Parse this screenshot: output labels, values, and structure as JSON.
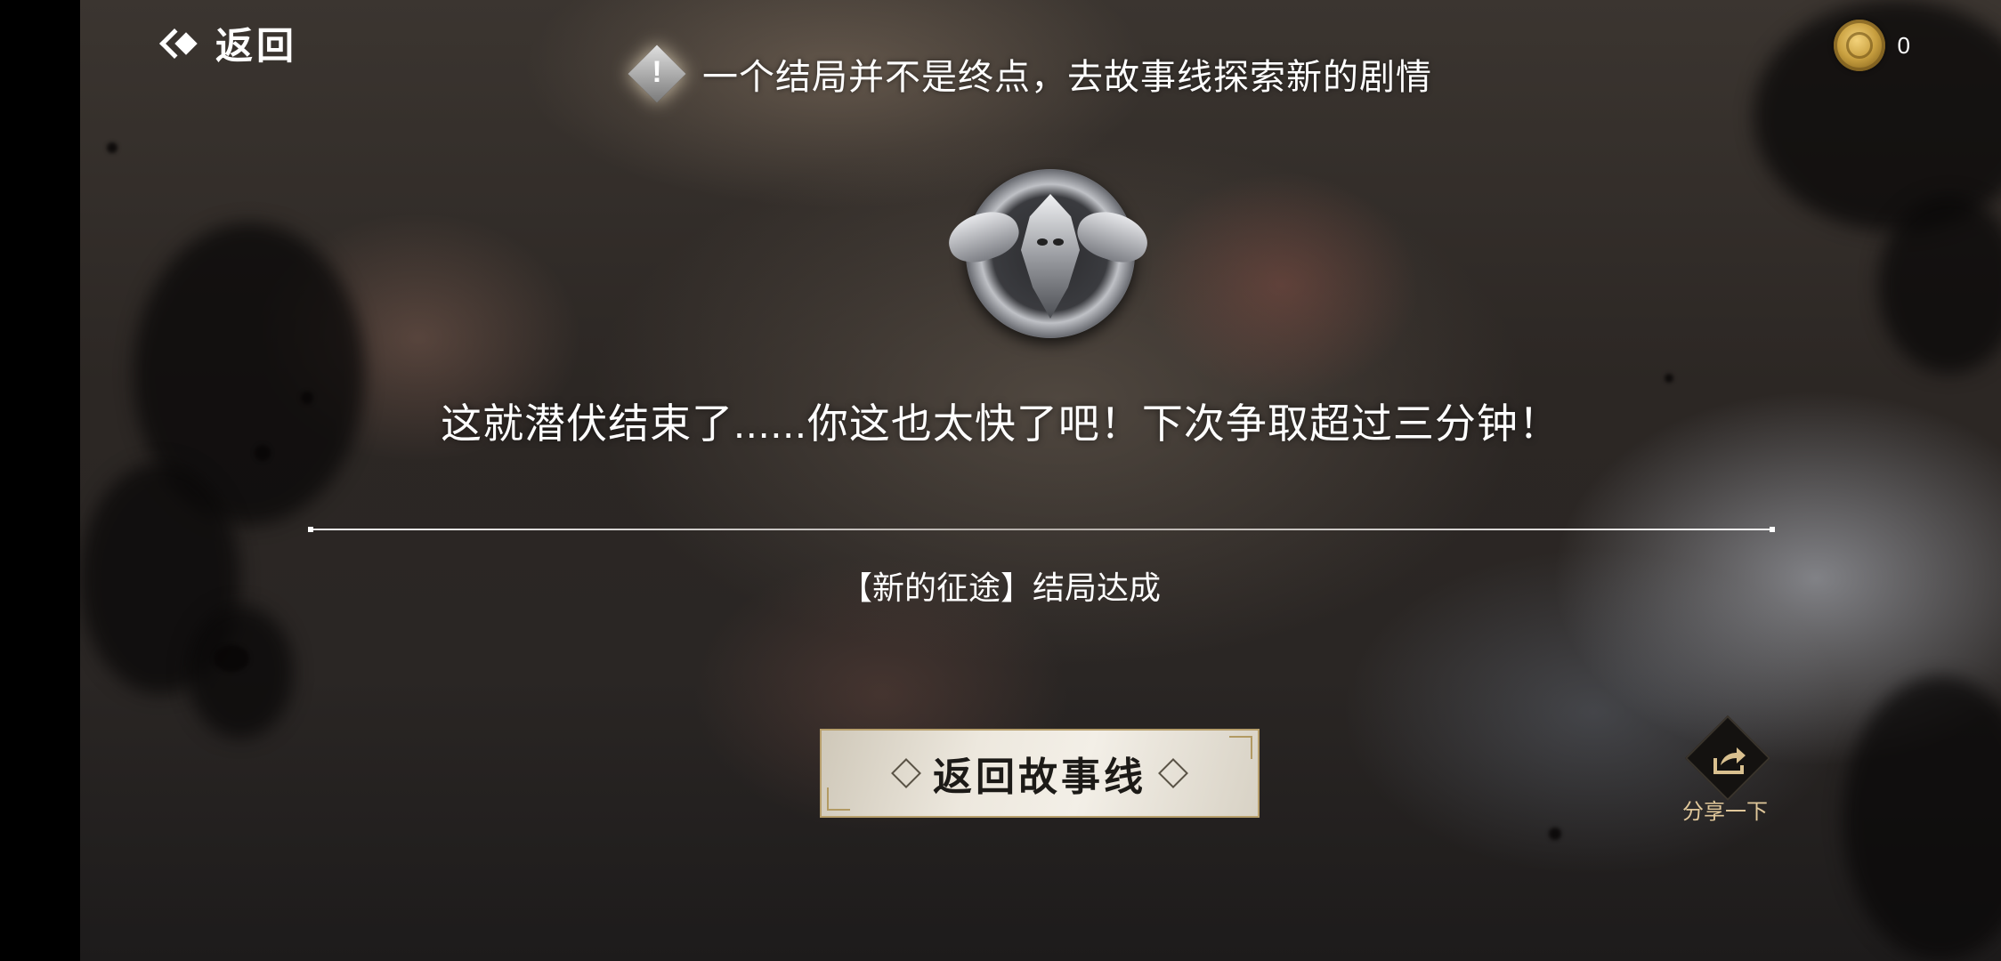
{
  "header": {
    "back_label": "返回",
    "hint_text": "一个结局并不是终点，去故事线探索新的剧情",
    "coin_count": "0"
  },
  "result": {
    "message": "这就潜伏结束了......你这也太快了吧！下次争取超过三分钟！",
    "ending_title": "【新的征途】结局达成"
  },
  "actions": {
    "return_story_label": "返回故事线",
    "share_label": "分享一下"
  },
  "icons": {
    "back": "back-arrow-icon",
    "hint": "exclamation-diamond-icon",
    "coin": "coin-icon",
    "emblem": "insect-emblem-badge",
    "share": "share-icon"
  },
  "colors": {
    "text": "#ffffff",
    "share_label": "#e0c79a",
    "button_bg": "#ede8de",
    "button_text": "#1c1a17",
    "coin_gold": "#c9a040"
  }
}
